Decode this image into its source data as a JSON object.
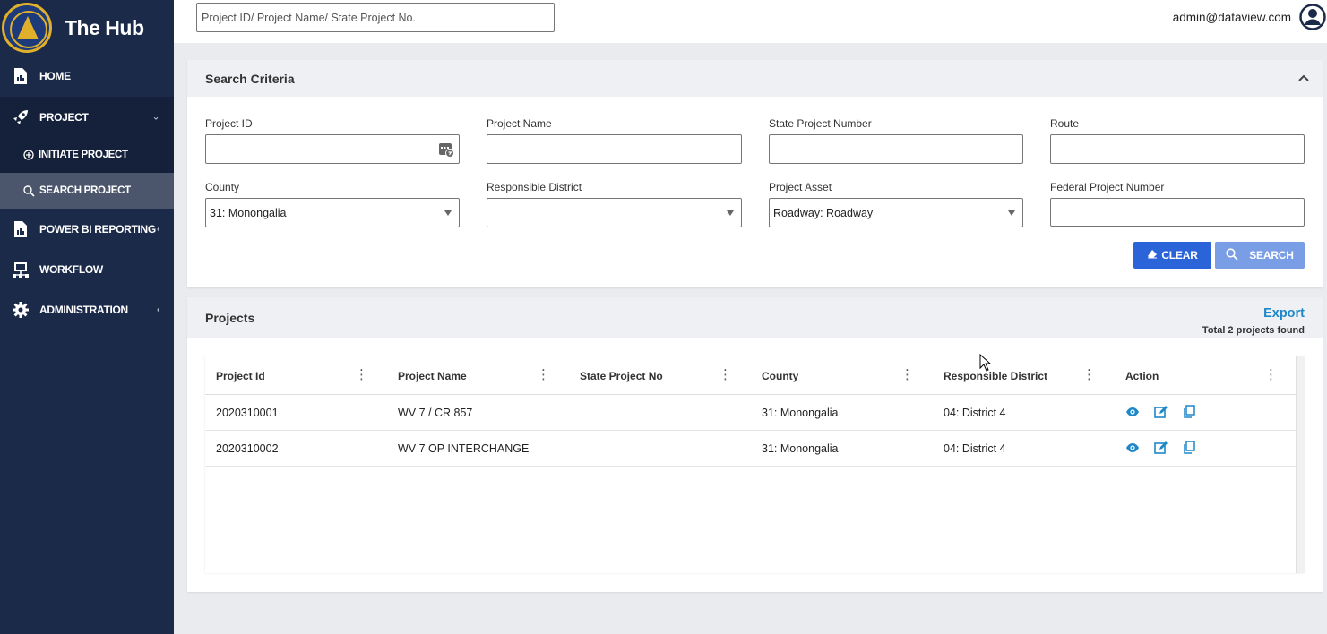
{
  "app": {
    "title": "The Hub"
  },
  "sidebar": {
    "items": [
      {
        "label": "HOME",
        "icon": "report-icon"
      },
      {
        "label": "PROJECT",
        "icon": "rocket-icon"
      },
      {
        "label": "INITIATE PROJECT",
        "icon": "plus-circle-icon"
      },
      {
        "label": "SEARCH PROJECT",
        "icon": "search-icon"
      },
      {
        "label": "POWER BI REPORTING",
        "icon": "report-icon"
      },
      {
        "label": "WORKFLOW",
        "icon": "network-icon"
      },
      {
        "label": "ADMINISTRATION",
        "icon": "gear-icon"
      }
    ]
  },
  "topbar": {
    "search_placeholder": "Project ID/ Project Name/ State Project No.",
    "user_email": "admin@dataview.com"
  },
  "criteria": {
    "title": "Search Criteria",
    "fields": {
      "project_id": {
        "label": "Project ID",
        "value": ""
      },
      "project_name": {
        "label": "Project Name",
        "value": ""
      },
      "state_project_number": {
        "label": "State Project Number",
        "value": ""
      },
      "route": {
        "label": "Route",
        "value": ""
      },
      "county": {
        "label": "County",
        "value": "31: Monongalia"
      },
      "responsible_district": {
        "label": "Responsible District",
        "value": ""
      },
      "project_asset": {
        "label": "Project Asset",
        "value": "Roadway: Roadway"
      },
      "federal_project_number": {
        "label": "Federal Project Number",
        "value": ""
      }
    },
    "clear_label": "CLEAR",
    "search_label": "SEARCH"
  },
  "projects": {
    "title": "Projects",
    "export_label": "Export",
    "total_text": "Total 2 projects found",
    "columns": [
      "Project Id",
      "Project Name",
      "State Project No",
      "County",
      "Responsible District",
      "Action"
    ],
    "rows": [
      {
        "project_id": "2020310001",
        "project_name": "WV 7 / CR 857",
        "state_project_no": "",
        "county": "31: Monongalia",
        "district": "04: District 4"
      },
      {
        "project_id": "2020310002",
        "project_name": "WV 7 OP INTERCHANGE",
        "state_project_no": "",
        "county": "31: Monongalia",
        "district": "04: District 4"
      }
    ]
  },
  "colors": {
    "sidebar_bg": "#1c2a4a",
    "sidebar_active": "#4b566c",
    "primary_button": "#2b63d9",
    "secondary_button": "#7a9ee6",
    "link": "#1e87c8"
  }
}
